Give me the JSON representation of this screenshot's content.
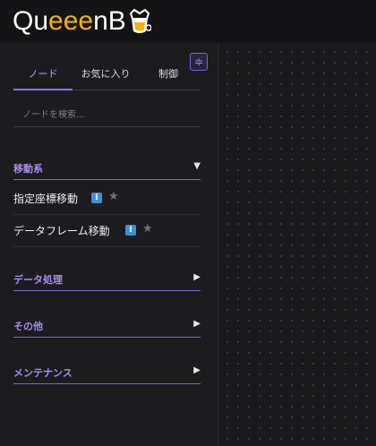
{
  "header": {
    "logo_prefix": "Qu",
    "logo_e": "eee",
    "logo_suffix": "nB"
  },
  "sidebar": {
    "tabs": [
      {
        "label": "ノード",
        "active": true
      },
      {
        "label": "お気に入り",
        "active": false
      },
      {
        "label": "制御",
        "active": false
      }
    ],
    "search_placeholder": "ノードを検索...",
    "sections": [
      {
        "label": "移動系",
        "expanded": true,
        "arrow": "▼",
        "items": [
          {
            "label": "指定座標移動",
            "info": "i",
            "star": "★"
          },
          {
            "label": "データフレーム移動",
            "info": "i",
            "star": "★"
          }
        ]
      },
      {
        "label": "データ処理",
        "expanded": false,
        "arrow": "▶"
      },
      {
        "label": "その他",
        "expanded": false,
        "arrow": "▶"
      },
      {
        "label": "メンテナンス",
        "expanded": false,
        "arrow": "▶"
      }
    ]
  },
  "colors": {
    "accent": "#8f6bf3",
    "section_label": "#a88bf0",
    "logo_accent": "#f4b400",
    "info_badge": "#3d8fe0"
  },
  "icons": {
    "collapse": "≑"
  }
}
